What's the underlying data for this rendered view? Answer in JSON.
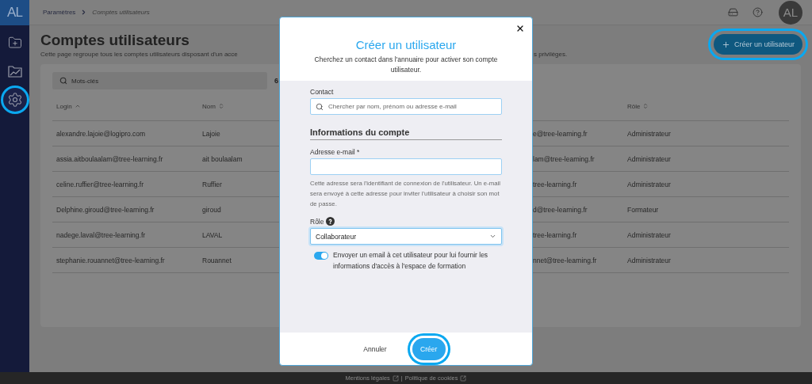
{
  "sidebar": {
    "logo": "AL",
    "items": [
      {
        "kind": "folder-plus",
        "selected": false,
        "highlighted": false
      },
      {
        "kind": "chart-folder",
        "selected": false,
        "highlighted": false
      },
      {
        "kind": "settings",
        "selected": true,
        "highlighted": true
      }
    ]
  },
  "breadcrumb": {
    "parent": "Paramètres",
    "current": "Comptes utilisateurs"
  },
  "header": {
    "avatar": "AL"
  },
  "page": {
    "title": "Comptes utilisateurs",
    "subtitle_parts": [
      "Cette page regroupe tous les comptes utilisateurs disposant d'un acce",
      "s privilèges."
    ],
    "create_button": {
      "label": "Créer un utilisateur",
      "highlighted": true
    }
  },
  "table": {
    "search_placeholder": "Mots-clés",
    "count": "6",
    "columns": [
      {
        "label": "Login",
        "kind": "sorted-ascending"
      },
      {
        "label": "Nom",
        "kind": "sortable"
      },
      {
        "label": "Rôle",
        "kind": "sortable"
      }
    ],
    "rows": [
      {
        "login": "alexandre.lajoie@logipro.com",
        "nom": "Lajoie",
        "column_3": "e@tree-learning.fr",
        "role": "Administrateur"
      },
      {
        "login": "assia.aitboulaalam@tree-learning.fr",
        "nom": "ait boulaalam",
        "column_3": "lam@tree-learning.fr",
        "role": "Administrateur"
      },
      {
        "login": "celine.ruffier@tree-learning.fr",
        "nom": "Ruffier",
        "column_3": "tree-learning.fr",
        "role": "Administrateur"
      },
      {
        "login": "Delphine.giroud@tree-learning.fr",
        "nom": "giroud",
        "column_3": "d@tree-learning.fr",
        "role": "Formateur"
      },
      {
        "login": "nadege.laval@tree-learning.fr",
        "nom": "LAVAL",
        "column_3": "tree-learning.fr",
        "role": "Administrateur"
      },
      {
        "login": "stephanie.rouannet@tree-learning.fr",
        "nom": "Rouannet",
        "column_3": "nnet@tree-learning.fr",
        "role": "Administrateur"
      }
    ]
  },
  "modal": {
    "title": "Créer un utilisateur",
    "subtitle": "Cherchez un contact dans l'annuaire pour activer son compte utilisateur.",
    "contact": {
      "label": "Contact",
      "placeholder": "Chercher par nom, prénom ou adresse e-mail"
    },
    "section_title": "Informations du compte",
    "email": {
      "label": "Adresse e-mail *",
      "help": "Cette adresse sera l'identifiant de connexion de l'utilisateur. Un e-mail sera envoyé à cette adresse pour inviter l'utilisateur à choisir son mot de passe."
    },
    "role": {
      "label": "Rôle",
      "value": "Collaborateur"
    },
    "notify": {
      "on": true,
      "label": "Envoyer un email à cet utilisateur pour lui fournir les informations d'accès à l'espace de formation"
    },
    "cancel": "Annuler",
    "submit": {
      "label": "Créer",
      "highlighted": true
    }
  },
  "footer": {
    "links": [
      "Mentions légales",
      "Politique de cookies"
    ],
    "separator": "|"
  }
}
